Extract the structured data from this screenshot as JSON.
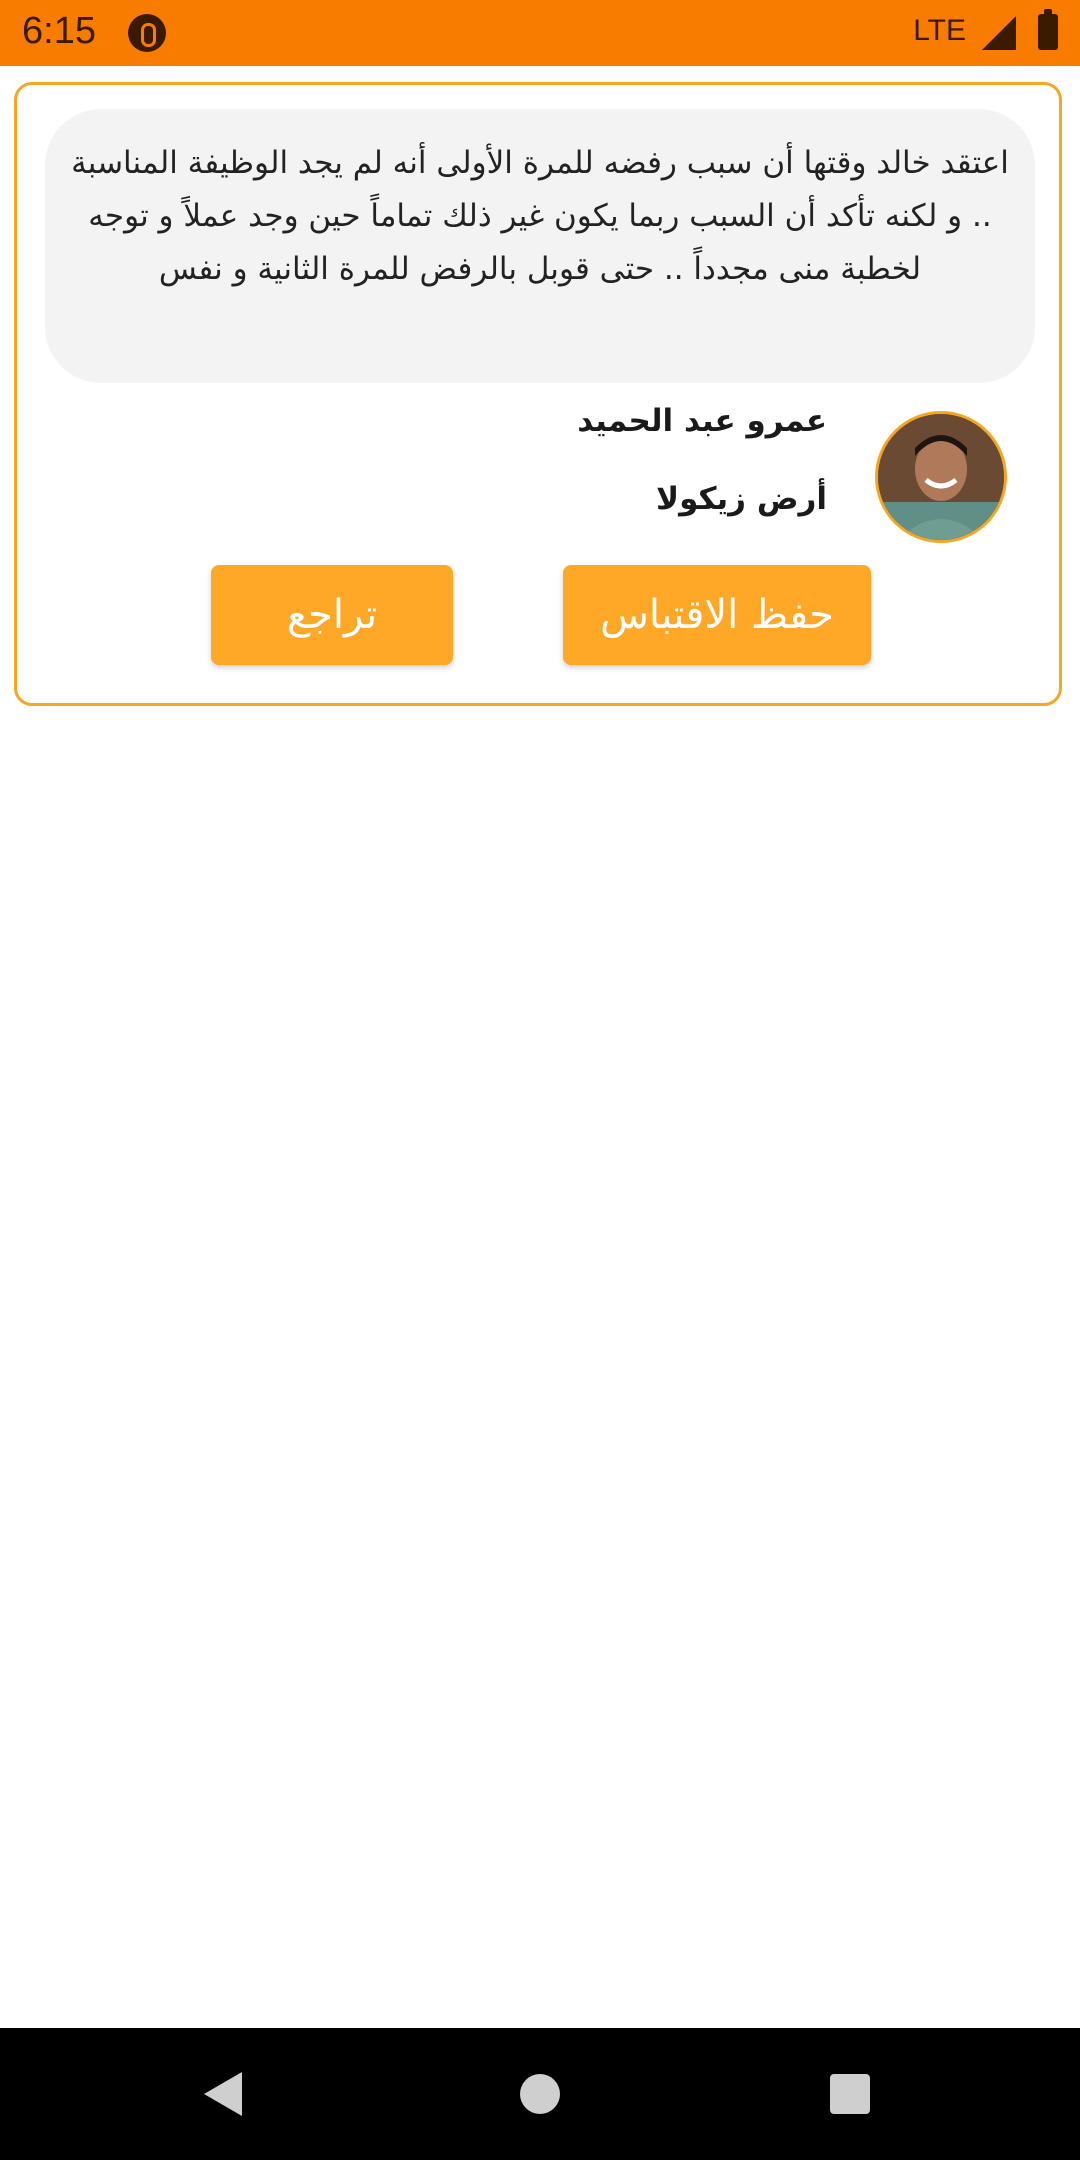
{
  "status_bar": {
    "time": "6:15",
    "network": "LTE",
    "color": "#f77c00",
    "icons": [
      "app-notification-icon",
      "signal-icon",
      "battery-icon"
    ]
  },
  "quote": {
    "text": "اعتقد خالد وقتها أن سبب رفضه للمرة الأولى أنه لم يجد الوظيفة المناسبة .. و لكنه تأكد أن السبب ربما يكون غير ذلك تماماً حين وجد عملاً و توجه لخطبة منى مجدداً .. حتى قوبل بالرفض للمرة الثانية و نفس",
    "author_name": "عمرو عبد الحميد",
    "book_title": "أرض زيكولا"
  },
  "actions": {
    "save_label": "حفظ الاقتباس",
    "back_label": "تراجع",
    "accent_color": "#ffa726",
    "border_color": "#f5a623"
  },
  "nav_bar": {
    "icons": [
      "back-icon",
      "home-icon",
      "recents-icon"
    ]
  }
}
